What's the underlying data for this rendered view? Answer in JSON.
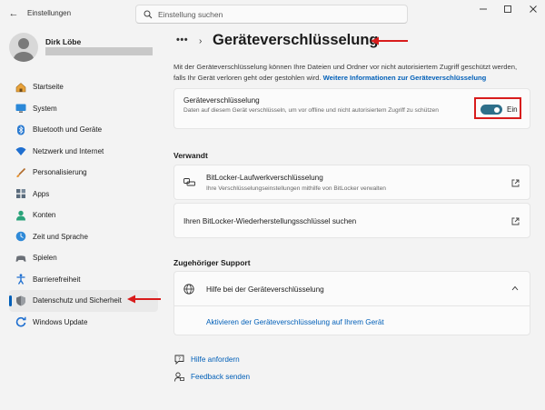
{
  "window": {
    "app_title": "Einstellungen"
  },
  "search": {
    "placeholder": "Einstellung suchen"
  },
  "profile": {
    "name": "Dirk Löbe"
  },
  "sidebar": {
    "items": [
      {
        "label": "Startseite",
        "icon": "home-icon"
      },
      {
        "label": "System",
        "icon": "monitor-icon"
      },
      {
        "label": "Bluetooth und Geräte",
        "icon": "bluetooth-icon"
      },
      {
        "label": "Netzwerk und Internet",
        "icon": "wifi-icon"
      },
      {
        "label": "Personalisierung",
        "icon": "brush-icon"
      },
      {
        "label": "Apps",
        "icon": "apps-icon"
      },
      {
        "label": "Konten",
        "icon": "person-icon"
      },
      {
        "label": "Zeit und Sprache",
        "icon": "globe-clock-icon"
      },
      {
        "label": "Spielen",
        "icon": "gamepad-icon"
      },
      {
        "label": "Barrierefreiheit",
        "icon": "accessibility-icon"
      },
      {
        "label": "Datenschutz und Sicherheit",
        "icon": "shield-icon",
        "active": true
      },
      {
        "label": "Windows Update",
        "icon": "update-icon"
      }
    ]
  },
  "breadcrumb": {
    "more": "•••",
    "separator": "›"
  },
  "page": {
    "title": "Geräteverschlüsselung",
    "intro": "Mit der Geräteverschlüsselung können Ihre Dateien und Ordner vor nicht autorisiertem Zugriff geschützt werden, falls Ihr Gerät verloren geht oder gestohlen wird.",
    "intro_link": "Weitere Informationen zur Geräteverschlüsselung"
  },
  "encryption_card": {
    "title": "Geräteverschlüsselung",
    "description": "Daten auf diesem Gerät verschlüsseln, um vor offline und nicht autorisiertem Zugriff zu schützen",
    "toggle_state": "Ein",
    "toggle_on": true
  },
  "related": {
    "heading": "Verwandt",
    "bitlocker_title": "BitLocker-Laufwerkverschlüsselung",
    "bitlocker_desc": "Ihre Verschlüsselungseinstellungen mithilfe von BitLocker verwalten",
    "recovery_title": "Ihren BitLocker-Wiederherstellungsschlüssel suchen"
  },
  "support": {
    "heading": "Zugehöriger Support",
    "help_title": "Hilfe bei der Geräteverschlüsselung",
    "activate_link": "Aktivieren der Geräteverschlüsselung auf Ihrem Gerät"
  },
  "footer": {
    "get_help": "Hilfe anfordern",
    "feedback": "Feedback senden"
  },
  "colors": {
    "accent": "#005fb8",
    "toggle_on": "#2e6f8a",
    "annotation_red": "#d81c1c"
  }
}
